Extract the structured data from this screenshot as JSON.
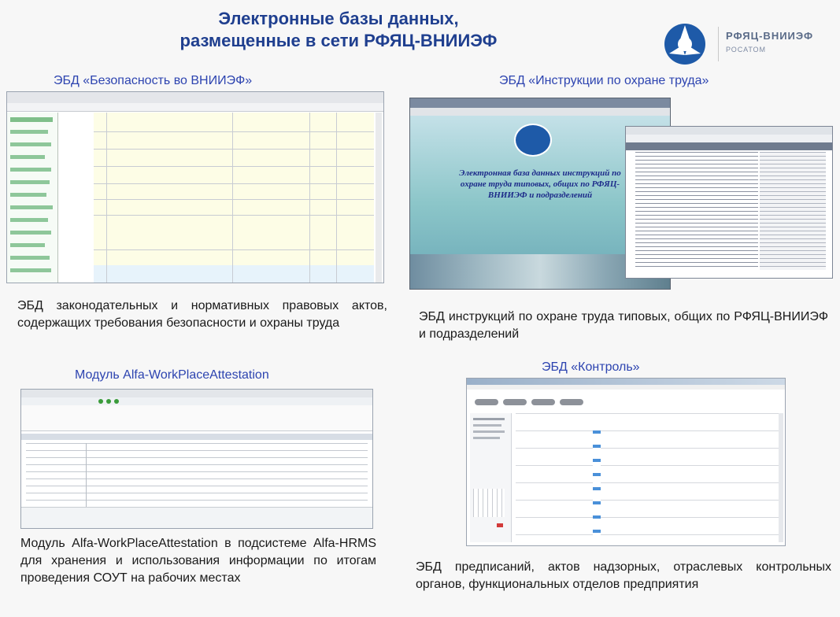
{
  "title": {
    "line1": "Электронные базы данных,",
    "line2": "размещенные в сети РФЯЦ-ВНИИЭФ"
  },
  "logo": {
    "name": "РФЯЦ-ВНИИЭФ",
    "sub": "РОСАТОМ"
  },
  "panels": {
    "safety": {
      "caption": "ЭБД «Безопасность во ВНИИЭФ»",
      "description": "ЭБД законодательных и нормативных правовых актов, содержащих требования безопасности и охраны труда"
    },
    "instructions": {
      "caption": "ЭБД «Инструкции по охране труда»",
      "description": "ЭБД инструкций по охране труда типовых, общих по РФЯЦ-ВНИИЭФ и подразделений",
      "splash_text": "Электронная база данных инструкций по охране труда типовых, общих по РФЯЦ-ВНИИЭФ и подразделений"
    },
    "alfa": {
      "caption": "Модуль Alfa-WorkPlaceAttestation",
      "description": "Модуль Alfa-WorkPlaceAttestation в подсистеме Alfa-HRMS для хранения и использования информации по итогам проведения СОУТ на рабочих местах"
    },
    "control": {
      "caption": "ЭБД «Контроль»",
      "description": "ЭБД предписаний, актов надзорных, отраслевых контрольных органов, функциональных отделов предприятия"
    }
  },
  "colors": {
    "title": "#1f3f8f",
    "caption": "#2d44b0",
    "logo_blue": "#1e5aa8"
  }
}
